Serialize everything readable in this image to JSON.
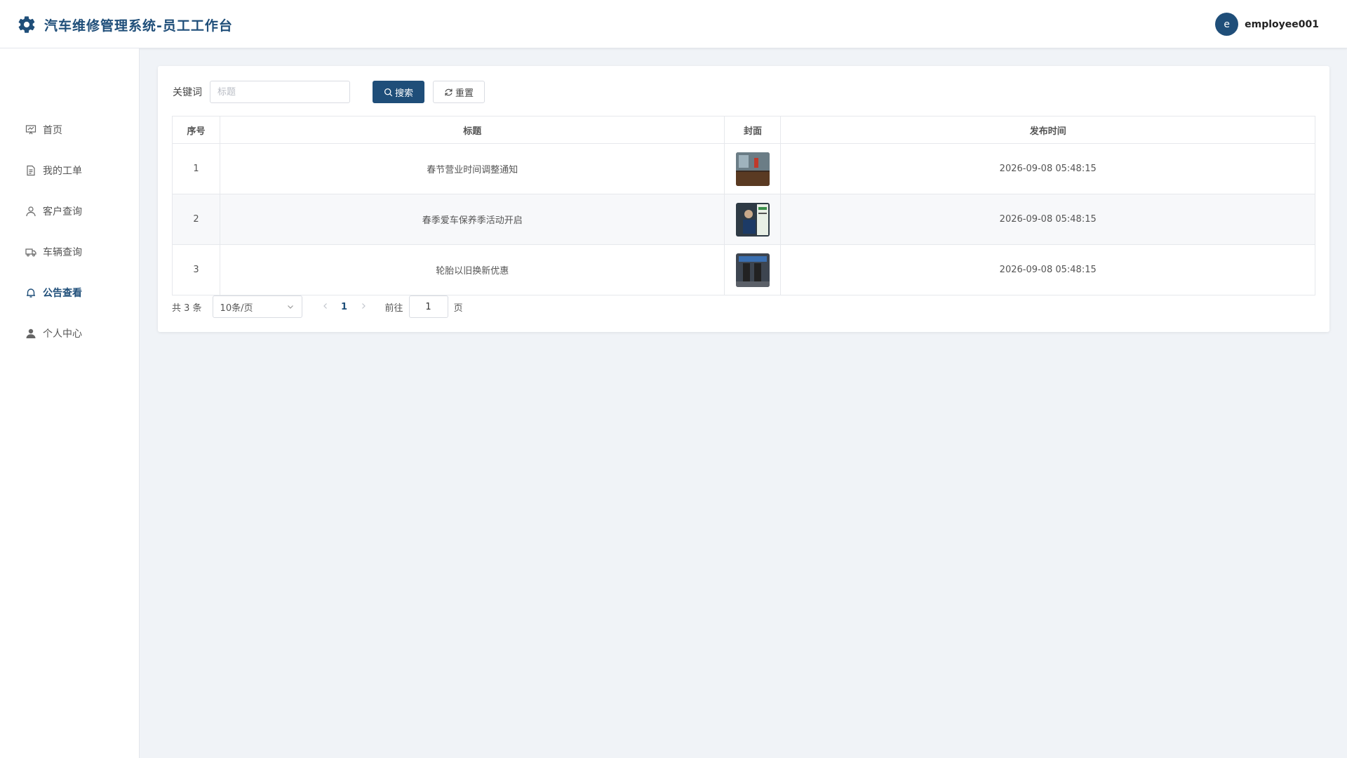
{
  "header": {
    "app_title": "汽车维修管理系统-员工工作台",
    "avatar_letter": "e",
    "username": "employee001"
  },
  "sidebar": {
    "items": [
      {
        "label": "首页",
        "icon": "dashboard-icon",
        "active": false
      },
      {
        "label": "我的工单",
        "icon": "document-icon",
        "active": false
      },
      {
        "label": "客户查询",
        "icon": "user-icon",
        "active": false
      },
      {
        "label": "车辆查询",
        "icon": "truck-icon",
        "active": false
      },
      {
        "label": "公告查看",
        "icon": "bell-icon",
        "active": true
      },
      {
        "label": "个人中心",
        "icon": "user-filled-icon",
        "active": false
      }
    ]
  },
  "search": {
    "keyword_label": "关键词",
    "placeholder": "标题",
    "value": "",
    "search_label": "搜索",
    "reset_label": "重置"
  },
  "table": {
    "columns": [
      "序号",
      "标题",
      "封面",
      "发布时间"
    ],
    "rows": [
      {
        "index": "1",
        "title": "春节营业时间调整通知",
        "cover": "cover-image",
        "time": "2026-09-08 05:48:15"
      },
      {
        "index": "2",
        "title": "春季爱车保养季活动开启",
        "cover": "cover-image",
        "time": "2026-09-08 05:48:15"
      },
      {
        "index": "3",
        "title": "轮胎以旧换新优惠",
        "cover": "cover-image",
        "time": "2026-09-08 05:48:15"
      }
    ]
  },
  "pagination": {
    "total_text": "共 3 条",
    "page_size": "10条/页",
    "current_page": "1",
    "goto_label": "前往",
    "goto_value": "1",
    "page_unit": "页"
  },
  "colors": {
    "primary": "#1f4e79",
    "background": "#f0f3f7"
  }
}
